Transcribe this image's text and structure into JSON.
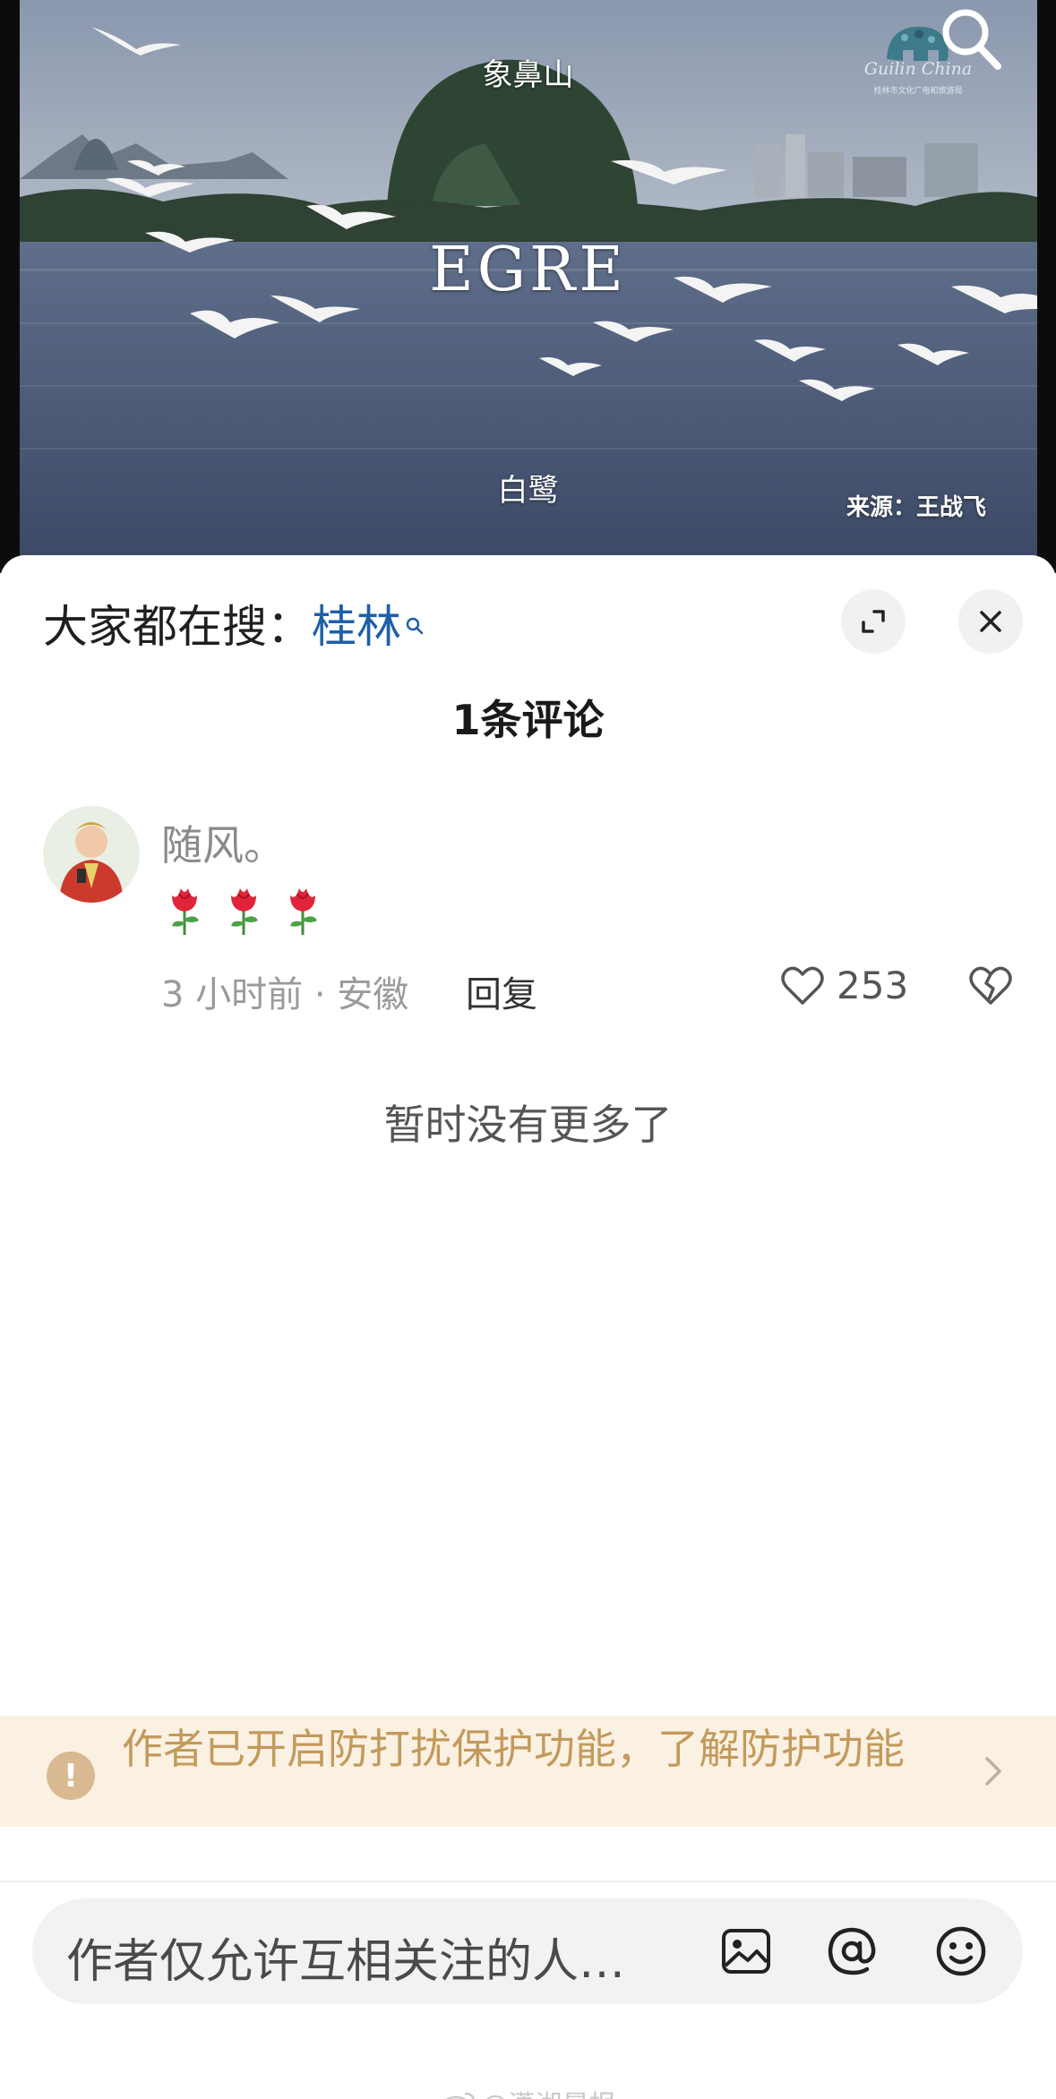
{
  "video": {
    "caption_top": "象鼻山",
    "title": "EGRE",
    "caption_bottom": "白鹭",
    "source": "来源：王战飞",
    "logo_text": "Guilin China",
    "logo_subtext": "桂林市文化广电和旅游局"
  },
  "sheet": {
    "search_prefix": "大家都在搜：",
    "search_term": "桂林",
    "title": "1条评论"
  },
  "comment": {
    "username": "随风。",
    "emojis": [
      "rose",
      "rose",
      "rose"
    ],
    "meta": "3 小时前 · 安徽",
    "reply_label": "回复",
    "like_count": "253"
  },
  "list_end_text": "暂时没有更多了",
  "banner": {
    "text": "作者已开启防打扰保护功能，了解防护功能",
    "icon": "exclamation-icon",
    "color_bg": "#fbf1e2",
    "color_text": "#c39a5c"
  },
  "composer": {
    "placeholder": "作者仅允许互相关注的人…"
  },
  "watermark": "@潇湘晨报",
  "colors": {
    "accent_link": "#1e5fa8"
  }
}
